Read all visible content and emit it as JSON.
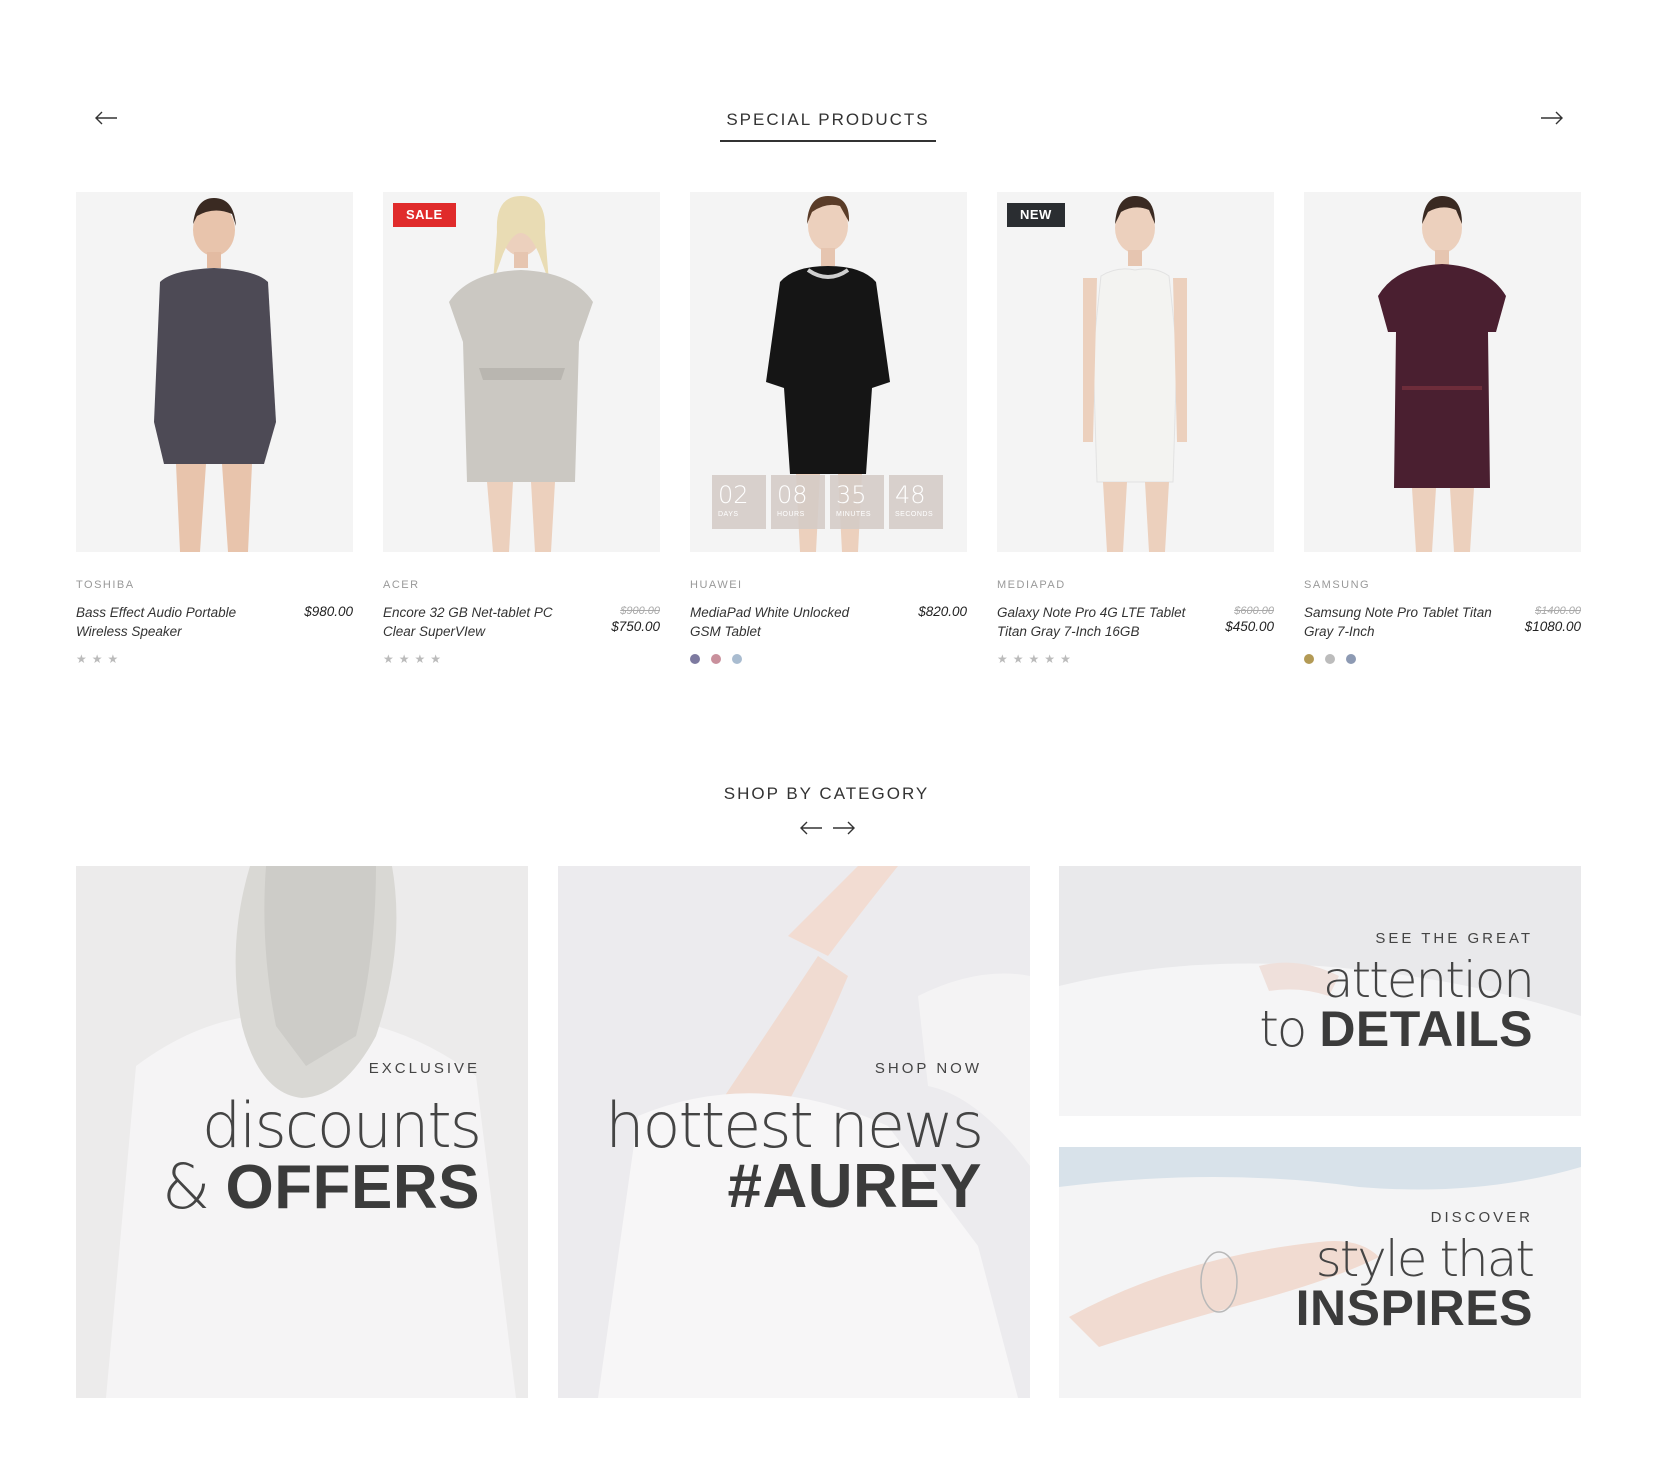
{
  "special": {
    "title": "SPECIAL PRODUCTS",
    "prev_icon": "arrow-left-icon",
    "next_icon": "arrow-right-icon"
  },
  "products": [
    {
      "brand": "TOSHIBA",
      "name": "Bass Effect Audio  Portable Wireless Speaker",
      "old_price": "",
      "price": "$980.00",
      "badge": "",
      "rating": 3,
      "dress_color": "#4d4a55"
    },
    {
      "brand": "ACER",
      "name": "Encore 32 GB Net-tablet PC Clear SuperVIew",
      "old_price": "$900.00",
      "price": "$750.00",
      "badge": "SALE",
      "rating": 4,
      "dress_color": "#cbc8c2"
    },
    {
      "brand": "HUAWEI",
      "name": "MediaPad White Unlocked GSM Tablet",
      "old_price": "",
      "price": "$820.00",
      "badge": "",
      "swatches": [
        "#7d7aa0",
        "#c9909c",
        "#a9bcd0"
      ],
      "dress_color": "#151515",
      "countdown": [
        {
          "value": "02",
          "label": "DAYS"
        },
        {
          "value": "08",
          "label": "HOURS"
        },
        {
          "value": "35",
          "label": "MINUTES"
        },
        {
          "value": "48",
          "label": "SECONDS"
        }
      ]
    },
    {
      "brand": "MEDIAPAD",
      "name": "Galaxy Note Pro 4G LTE Tablet Titan Gray 7-Inch 16GB",
      "old_price": "$600.00",
      "price": "$450.00",
      "badge": "NEW",
      "rating": 5,
      "dress_color": "#f3f3f1"
    },
    {
      "brand": "SAMSUNG",
      "name": "Samsung Note Pro Tablet Titan Gray 7-Inch",
      "old_price": "$1400.00",
      "price": "$1080.00",
      "badge": "",
      "swatches": [
        "#b39a55",
        "#bcbcbc",
        "#8d9ab3"
      ],
      "dress_color": "#4a1f30"
    }
  ],
  "category": {
    "title": "SHOP BY CATEGORY",
    "tiles": [
      {
        "kicker": "EXCLUSIVE",
        "light": "discounts",
        "amp": "&",
        "bold": "OFFERS"
      },
      {
        "kicker": "SHOP NOW",
        "light": "hottest news",
        "amp": "",
        "bold": "#AUREY"
      },
      {
        "kicker": "SEE THE GREAT",
        "light": "attention",
        "amp": "to",
        "bold": "DETAILS"
      },
      {
        "kicker": "DISCOVER",
        "light": "style that",
        "amp": "",
        "bold": "INSPIRES"
      }
    ]
  }
}
